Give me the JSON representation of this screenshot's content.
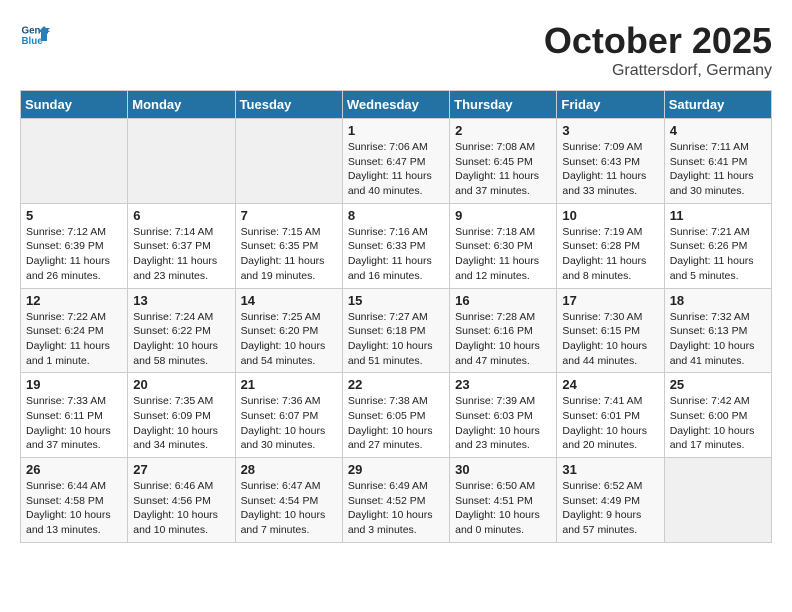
{
  "header": {
    "logo_general": "General",
    "logo_blue": "Blue",
    "title": "October 2025",
    "subtitle": "Grattersdorf, Germany"
  },
  "weekdays": [
    "Sunday",
    "Monday",
    "Tuesday",
    "Wednesday",
    "Thursday",
    "Friday",
    "Saturday"
  ],
  "weeks": [
    [
      {
        "day": "",
        "empty": true
      },
      {
        "day": "",
        "empty": true
      },
      {
        "day": "",
        "empty": true
      },
      {
        "day": "1",
        "sunrise": "7:06 AM",
        "sunset": "6:47 PM",
        "daylight": "11 hours and 40 minutes."
      },
      {
        "day": "2",
        "sunrise": "7:08 AM",
        "sunset": "6:45 PM",
        "daylight": "11 hours and 37 minutes."
      },
      {
        "day": "3",
        "sunrise": "7:09 AM",
        "sunset": "6:43 PM",
        "daylight": "11 hours and 33 minutes."
      },
      {
        "day": "4",
        "sunrise": "7:11 AM",
        "sunset": "6:41 PM",
        "daylight": "11 hours and 30 minutes."
      }
    ],
    [
      {
        "day": "5",
        "sunrise": "7:12 AM",
        "sunset": "6:39 PM",
        "daylight": "11 hours and 26 minutes."
      },
      {
        "day": "6",
        "sunrise": "7:14 AM",
        "sunset": "6:37 PM",
        "daylight": "11 hours and 23 minutes."
      },
      {
        "day": "7",
        "sunrise": "7:15 AM",
        "sunset": "6:35 PM",
        "daylight": "11 hours and 19 minutes."
      },
      {
        "day": "8",
        "sunrise": "7:16 AM",
        "sunset": "6:33 PM",
        "daylight": "11 hours and 16 minutes."
      },
      {
        "day": "9",
        "sunrise": "7:18 AM",
        "sunset": "6:30 PM",
        "daylight": "11 hours and 12 minutes."
      },
      {
        "day": "10",
        "sunrise": "7:19 AM",
        "sunset": "6:28 PM",
        "daylight": "11 hours and 8 minutes."
      },
      {
        "day": "11",
        "sunrise": "7:21 AM",
        "sunset": "6:26 PM",
        "daylight": "11 hours and 5 minutes."
      }
    ],
    [
      {
        "day": "12",
        "sunrise": "7:22 AM",
        "sunset": "6:24 PM",
        "daylight": "11 hours and 1 minute."
      },
      {
        "day": "13",
        "sunrise": "7:24 AM",
        "sunset": "6:22 PM",
        "daylight": "10 hours and 58 minutes."
      },
      {
        "day": "14",
        "sunrise": "7:25 AM",
        "sunset": "6:20 PM",
        "daylight": "10 hours and 54 minutes."
      },
      {
        "day": "15",
        "sunrise": "7:27 AM",
        "sunset": "6:18 PM",
        "daylight": "10 hours and 51 minutes."
      },
      {
        "day": "16",
        "sunrise": "7:28 AM",
        "sunset": "6:16 PM",
        "daylight": "10 hours and 47 minutes."
      },
      {
        "day": "17",
        "sunrise": "7:30 AM",
        "sunset": "6:15 PM",
        "daylight": "10 hours and 44 minutes."
      },
      {
        "day": "18",
        "sunrise": "7:32 AM",
        "sunset": "6:13 PM",
        "daylight": "10 hours and 41 minutes."
      }
    ],
    [
      {
        "day": "19",
        "sunrise": "7:33 AM",
        "sunset": "6:11 PM",
        "daylight": "10 hours and 37 minutes."
      },
      {
        "day": "20",
        "sunrise": "7:35 AM",
        "sunset": "6:09 PM",
        "daylight": "10 hours and 34 minutes."
      },
      {
        "day": "21",
        "sunrise": "7:36 AM",
        "sunset": "6:07 PM",
        "daylight": "10 hours and 30 minutes."
      },
      {
        "day": "22",
        "sunrise": "7:38 AM",
        "sunset": "6:05 PM",
        "daylight": "10 hours and 27 minutes."
      },
      {
        "day": "23",
        "sunrise": "7:39 AM",
        "sunset": "6:03 PM",
        "daylight": "10 hours and 23 minutes."
      },
      {
        "day": "24",
        "sunrise": "7:41 AM",
        "sunset": "6:01 PM",
        "daylight": "10 hours and 20 minutes."
      },
      {
        "day": "25",
        "sunrise": "7:42 AM",
        "sunset": "6:00 PM",
        "daylight": "10 hours and 17 minutes."
      }
    ],
    [
      {
        "day": "26",
        "sunrise": "6:44 AM",
        "sunset": "4:58 PM",
        "daylight": "10 hours and 13 minutes."
      },
      {
        "day": "27",
        "sunrise": "6:46 AM",
        "sunset": "4:56 PM",
        "daylight": "10 hours and 10 minutes."
      },
      {
        "day": "28",
        "sunrise": "6:47 AM",
        "sunset": "4:54 PM",
        "daylight": "10 hours and 7 minutes."
      },
      {
        "day": "29",
        "sunrise": "6:49 AM",
        "sunset": "4:52 PM",
        "daylight": "10 hours and 3 minutes."
      },
      {
        "day": "30",
        "sunrise": "6:50 AM",
        "sunset": "4:51 PM",
        "daylight": "10 hours and 0 minutes."
      },
      {
        "day": "31",
        "sunrise": "6:52 AM",
        "sunset": "4:49 PM",
        "daylight": "9 hours and 57 minutes."
      },
      {
        "day": "",
        "empty": true
      }
    ]
  ]
}
